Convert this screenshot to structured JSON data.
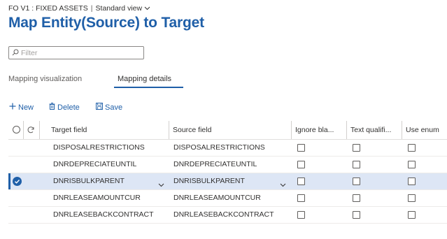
{
  "header": {
    "company": "FO V1 : FIXED ASSETS",
    "separator": "|",
    "view_label": "Standard view",
    "title": "Map Entity(Source) to Target"
  },
  "filter": {
    "placeholder": "Filter",
    "value": ""
  },
  "tabs": [
    {
      "label": "Mapping visualization",
      "active": false
    },
    {
      "label": "Mapping details",
      "active": true
    }
  ],
  "actions": {
    "new_label": "New",
    "delete_label": "Delete",
    "save_label": "Save"
  },
  "grid": {
    "columns": [
      "Target field",
      "Source field",
      "Ignore bla...",
      "Text qualifi...",
      "Use enum"
    ],
    "rows": [
      {
        "target": "DISPOSALRESTRICTIONS",
        "source": "DISPOSALRESTRICTIONS",
        "selected": false
      },
      {
        "target": "DNRDEPRECIATEUNTIL",
        "source": "DNRDEPRECIATEUNTIL",
        "selected": false
      },
      {
        "target": "DNRISBULKPARENT",
        "source": "DNRISBULKPARENT",
        "selected": true
      },
      {
        "target": "DNRLEASEAMOUNTCUR",
        "source": "DNRLEASEAMOUNTCUR",
        "selected": false
      },
      {
        "target": "DNRLEASEBACKCONTRACT",
        "source": "DNRLEASEBACKCONTRACT",
        "selected": false
      }
    ]
  },
  "colors": {
    "accent": "#1f5fa8",
    "selected_row": "#dde6f5"
  }
}
